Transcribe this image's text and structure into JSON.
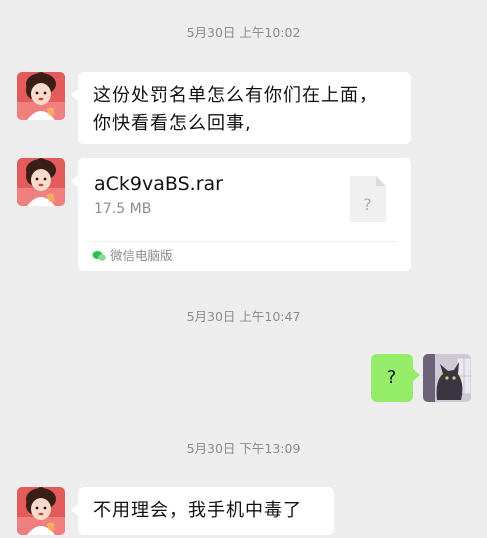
{
  "messages": {
    "ts1": "5月30日 上午10:02",
    "msg1_line1": "这份处罚名单怎么有你们在上面，",
    "msg1_line2": "你快看看怎么回事,",
    "file": {
      "name": "aCk9vaBS.rar",
      "size": "17.5 MB",
      "icon_mark": "?",
      "source": "微信电脑版"
    },
    "ts2": "5月30日 上午10:47",
    "msg_self": "?",
    "ts3": "5月30日 下午13:09",
    "msg3": "不用理会，我手机中毒了"
  },
  "icons": {
    "contact_avatar": "cartoon-girl-avatar",
    "self_avatar": "cat-avatar",
    "file_icon": "unknown-file-icon",
    "source_icon": "wechat-pc-icon"
  },
  "colors": {
    "background": "#ededed",
    "bubble_self": "#95ec69",
    "bubble_other": "#ffffff"
  }
}
